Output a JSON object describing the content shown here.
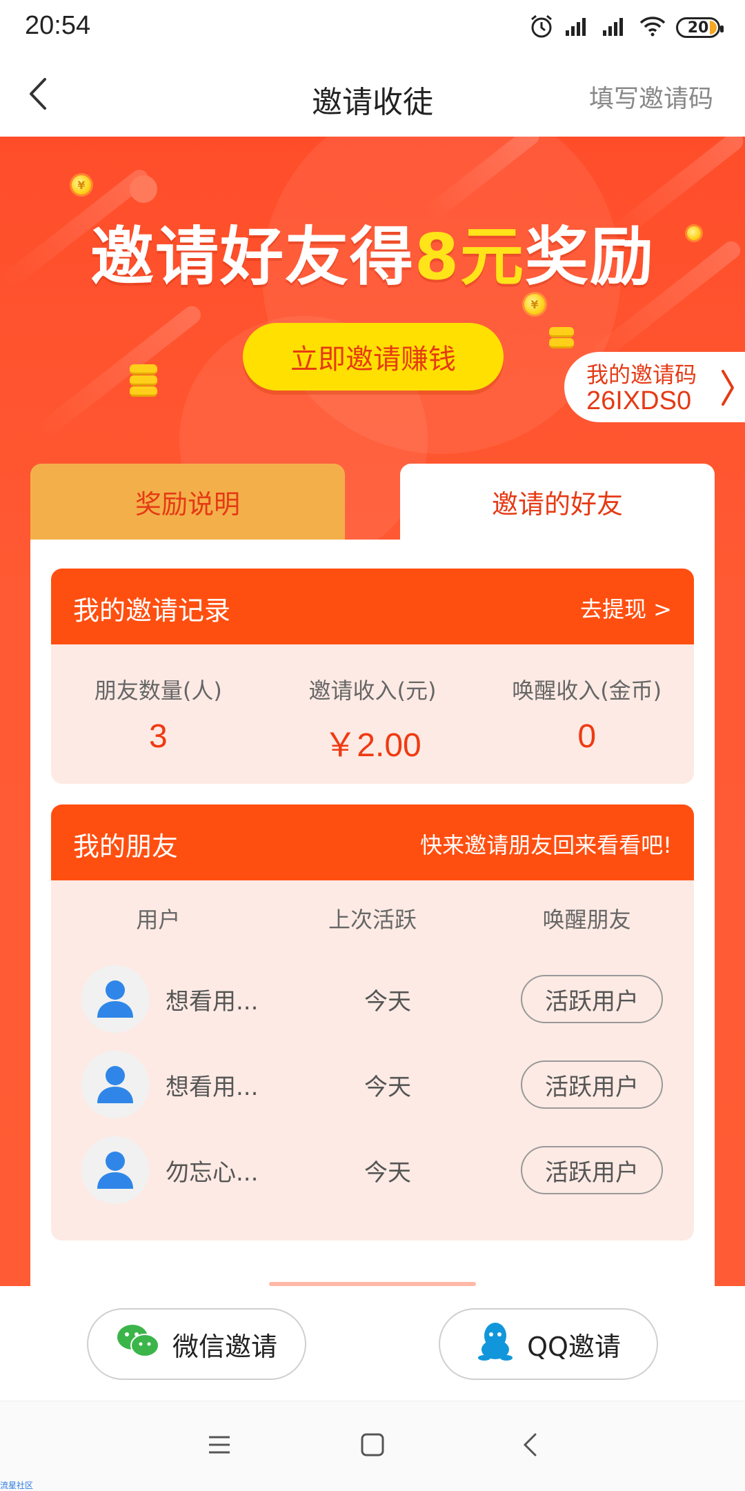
{
  "status_bar": {
    "time": "20:54",
    "battery": "20"
  },
  "header": {
    "title": "邀请收徒",
    "right_action": "填写邀请码"
  },
  "banner": {
    "headline_prefix": "邀请好友得",
    "headline_highlight": "8元",
    "headline_suffix": "奖励",
    "invite_button": "立即邀请赚钱",
    "code_label": "我的邀请码",
    "code_value": "26IXDS0"
  },
  "tabs": [
    {
      "label": "奖励说明",
      "active": false
    },
    {
      "label": "邀请的好友",
      "active": true
    }
  ],
  "records": {
    "title": "我的邀请记录",
    "action": "去提现 >",
    "stats": [
      {
        "label": "朋友数量(人)",
        "value": "3"
      },
      {
        "label": "邀请收入(元)",
        "value": "￥2.00"
      },
      {
        "label": "唤醒收入(金币)",
        "value": "0"
      }
    ]
  },
  "friends": {
    "title": "我的朋友",
    "subtitle": "快来邀请朋友回来看看吧!",
    "columns": [
      "用户",
      "上次活跃",
      "唤醒朋友"
    ],
    "rows": [
      {
        "name": "想看用...",
        "last_active": "今天",
        "action": "活跃用户"
      },
      {
        "name": "想看用...",
        "last_active": "今天",
        "action": "活跃用户"
      },
      {
        "name": "勿忘心...",
        "last_active": "今天",
        "action": "活跃用户"
      }
    ]
  },
  "share": {
    "wechat": "微信邀请",
    "qq": "QQ邀请"
  },
  "watermark": "流星社区",
  "colors": {
    "banner_red": "#ff5233",
    "card_header": "#ff4f10",
    "highlight_yellow": "#ffe41a",
    "accent_text": "#e53a15",
    "card_body": "#fdeae4"
  }
}
